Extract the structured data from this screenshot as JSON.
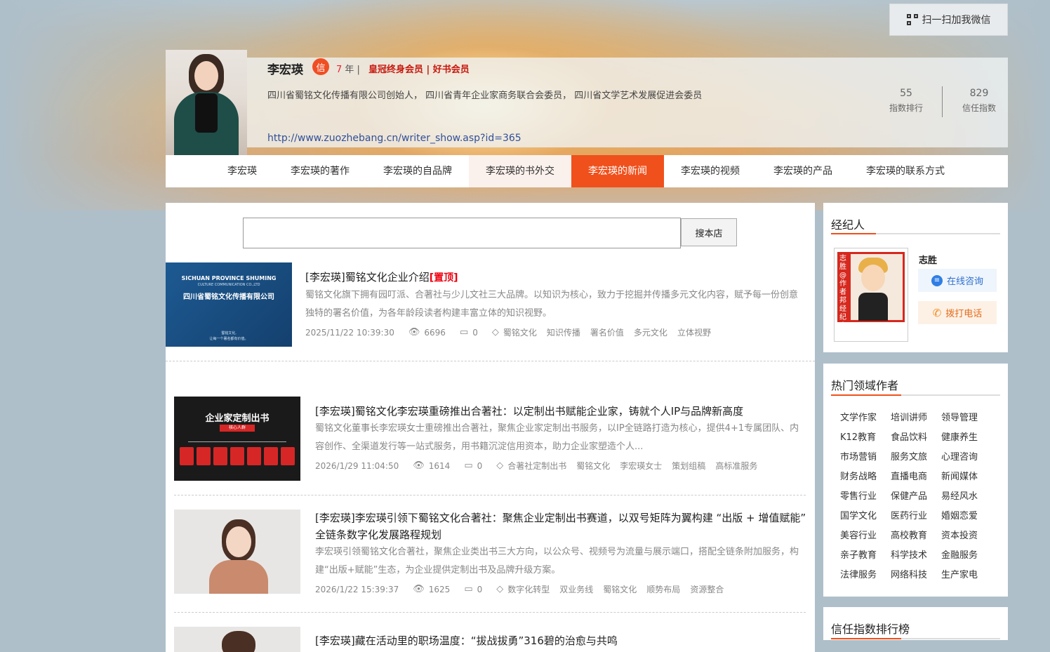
{
  "header": {
    "wechat_button": "扫一扫加我微信",
    "name": "李宏瑛",
    "badge": "信",
    "years_num": "7",
    "years_unit": "年 |",
    "membership": "皇冠终身会员 | 好书会员",
    "description": "四川省蜀铭文化传播有限公司创始人， 四川省青年企业家商务联合会委员， 四川省文学艺术发展促进会委员",
    "url": "http://www.zuozhebang.cn/writer_show.asp?id=365",
    "stats": [
      {
        "value": "55",
        "label": "指数排行"
      },
      {
        "value": "829",
        "label": "信任指数"
      }
    ]
  },
  "nav": [
    {
      "label": "李宏瑛"
    },
    {
      "label": "李宏瑛的著作"
    },
    {
      "label": "李宏瑛的自品牌"
    },
    {
      "label": "李宏瑛的书外交"
    },
    {
      "label": "李宏瑛的新闻"
    },
    {
      "label": "李宏瑛的视频"
    },
    {
      "label": "李宏瑛的产品"
    },
    {
      "label": "李宏瑛的联系方式"
    }
  ],
  "search": {
    "placeholder": "",
    "button": "搜本店"
  },
  "articles": [
    {
      "title": "[李宏瑛]蜀铭文化企业介绍",
      "top_label": "[置顶]",
      "summary": "蜀铭文化旗下拥有园叮派、合著社与少儿文社三大品牌。以知识为核心，致力于挖掘并传播多元文化内容，赋予每一份创意独特的署名价值，为各年龄段读者构建丰富立体的知识视野。",
      "date": "2025/11/22 10:39:30",
      "views": "6696",
      "comments": "0",
      "tags": [
        "蜀铭文化",
        "知识传播",
        "署名价值",
        "多元文化",
        "立体视野"
      ],
      "thumb_text_en": "SICHUAN PROVINCE SHUMING",
      "thumb_text_en2": "CULTURE COMMUNICATION CO.,LTD",
      "thumb_text_cn": "四川省蜀铭文化传播有限公司",
      "thumb_small1": "蜀铭文化,",
      "thumb_small2": "让每一个署名都有价值。"
    },
    {
      "title": "[李宏瑛]蜀铭文化李宏瑛重磅推出合著社：以定制出书赋能企业家，铸就个人IP与品牌新高度",
      "summary": "蜀铭文化董事长李宏瑛女士重磅推出合著社，聚焦企业家定制出书服务，以IP全链路打造为核心，提供4+1专属团队、内容创作、全渠道发行等一站式服务，用书籍沉淀信用资本，助力企业家塑造个人...",
      "date": "2026/1/29 11:04:50",
      "views": "1614",
      "comments": "0",
      "tags": [
        "合著社定制出书",
        "蜀铭文化",
        "李宏瑛女士",
        "策划组稿",
        "高标准服务"
      ],
      "thumb_title": "企业家定制出书",
      "thumb_sub": "核心人群"
    },
    {
      "title": "[李宏瑛]李宏瑛引领下蜀铭文化合著社：聚焦企业定制出书赛道，以双号矩阵为翼构建 “出版 + 增值赋能” 全链条数字化发展路程规划",
      "summary": "李宏瑛引领蜀铭文化合著社，聚焦企业类出书三大方向，以公众号、视频号为流量与展示端口，搭配全链条附加服务，构建“出版+赋能”生态，为企业提供定制出书及品牌升级方案。",
      "date": "2026/1/22 15:39:37",
      "views": "1625",
      "comments": "0",
      "tags": [
        "数字化转型",
        "双业务线",
        "蜀铭文化",
        "顺势布局",
        "资源整合"
      ]
    },
    {
      "title": "[李宏瑛]藏在活动里的职场温度：“拔战拔勇”316碧的治愈与共鸣"
    }
  ],
  "sidebar": {
    "agent": {
      "title": "经纪人",
      "name": "志胜",
      "pic_text": "志胜@作者邦经纪人",
      "consult": "在线咨询",
      "call": "拨打电话"
    },
    "hot": {
      "title": "热门领域作者",
      "tags": [
        "文学作家",
        "培训讲师",
        "领导管理",
        "K12教育",
        "食品饮料",
        "健康养生",
        "市场营销",
        "服务文旅",
        "心理咨询",
        "财务战略",
        "直播电商",
        "新闻媒体",
        "零售行业",
        "保健产品",
        "易经风水",
        "国学文化",
        "医药行业",
        "婚姻恋爱",
        "美容行业",
        "高校教育",
        "资本投资",
        "亲子教育",
        "科学技术",
        "金融服务",
        "法律服务",
        "网络科技",
        "生产家电"
      ]
    },
    "ranking": {
      "title": "信任指数排行榜"
    }
  },
  "colors": {
    "accent": "#f0501c",
    "top_red": "#e00011",
    "link_blue": "#2f4f9a"
  }
}
